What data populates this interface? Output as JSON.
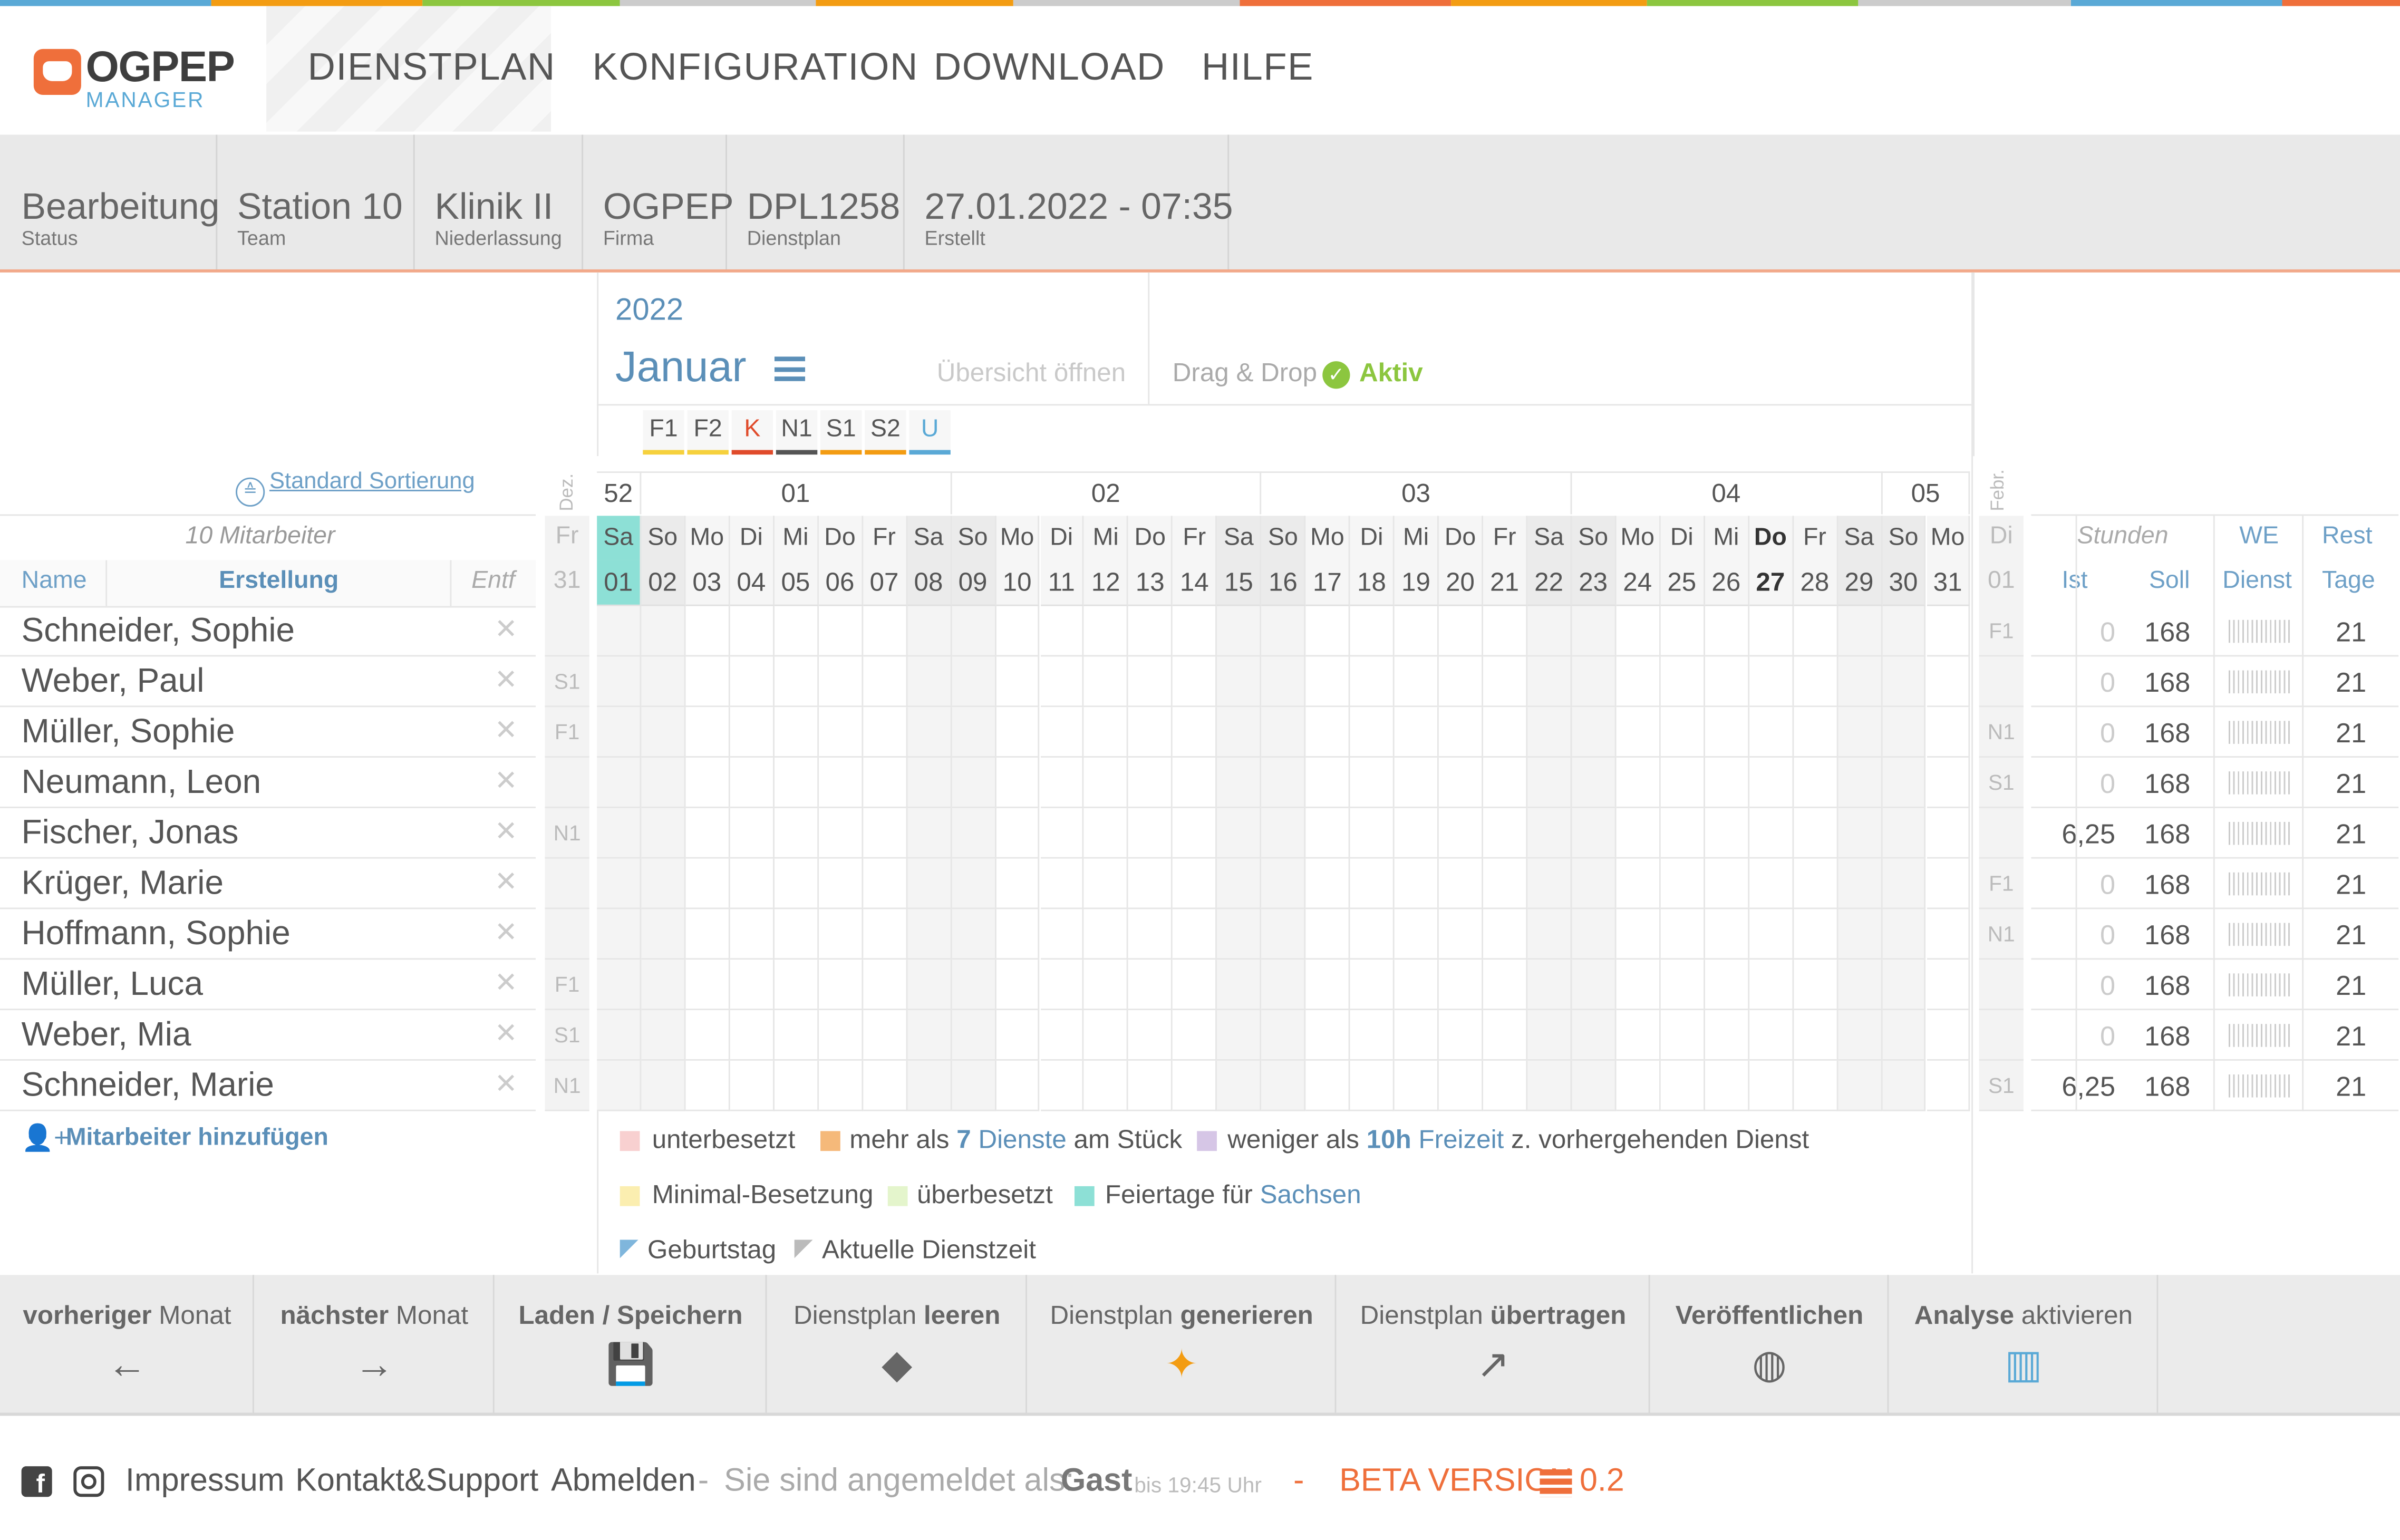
{
  "nav": {
    "logo_main": "OGPEP",
    "logo_sub": "MANAGER",
    "items": [
      "DIENSTPLAN",
      "KONFIGURATION",
      "DOWNLOAD",
      "HILFE"
    ]
  },
  "info": [
    {
      "value": "Bearbeitung",
      "label": "Status"
    },
    {
      "value": "Station 10",
      "label": "Team"
    },
    {
      "value": "Klinik II",
      "label": "Niederlassung"
    },
    {
      "value": "OGPEP",
      "label": "Firma"
    },
    {
      "value": "DPL1258",
      "label": "Dienstplan"
    },
    {
      "value": "27.01.2022 - 07:35",
      "label": "Erstellt"
    }
  ],
  "calendar": {
    "year": "2022",
    "month": "Januar",
    "overview_link": "Übersicht öffnen",
    "dragdrop_label": "Drag & Drop",
    "dragdrop_status": "Aktiv",
    "prev_month_label": "Dez.",
    "next_month_label": "Febr.",
    "shift_types": [
      {
        "code": "F1",
        "color": "#f6d13d"
      },
      {
        "code": "F2",
        "color": "#f6d13d"
      },
      {
        "code": "K",
        "color": "#e04b2b"
      },
      {
        "code": "N1",
        "color": "#555555"
      },
      {
        "code": "S1",
        "color": "#f39c12"
      },
      {
        "code": "S2",
        "color": "#f39c12"
      },
      {
        "code": "U",
        "color": "#5aa9d6"
      }
    ],
    "weeks": [
      "52",
      "01",
      "02",
      "03",
      "04",
      "05"
    ],
    "prev_day": {
      "dow": "Fr",
      "num": "31"
    },
    "next_day": {
      "dow": "Di",
      "num": "01"
    },
    "days": [
      {
        "dow": "Sa",
        "num": "01"
      },
      {
        "dow": "So",
        "num": "02"
      },
      {
        "dow": "Mo",
        "num": "03"
      },
      {
        "dow": "Di",
        "num": "04"
      },
      {
        "dow": "Mi",
        "num": "05"
      },
      {
        "dow": "Do",
        "num": "06"
      },
      {
        "dow": "Fr",
        "num": "07"
      },
      {
        "dow": "Sa",
        "num": "08"
      },
      {
        "dow": "So",
        "num": "09"
      },
      {
        "dow": "Mo",
        "num": "10"
      },
      {
        "dow": "Di",
        "num": "11"
      },
      {
        "dow": "Mi",
        "num": "12"
      },
      {
        "dow": "Do",
        "num": "13"
      },
      {
        "dow": "Fr",
        "num": "14"
      },
      {
        "dow": "Sa",
        "num": "15"
      },
      {
        "dow": "So",
        "num": "16"
      },
      {
        "dow": "Mo",
        "num": "17"
      },
      {
        "dow": "Di",
        "num": "18"
      },
      {
        "dow": "Mi",
        "num": "19"
      },
      {
        "dow": "Do",
        "num": "20"
      },
      {
        "dow": "Fr",
        "num": "21"
      },
      {
        "dow": "Sa",
        "num": "22"
      },
      {
        "dow": "So",
        "num": "23"
      },
      {
        "dow": "Mo",
        "num": "24"
      },
      {
        "dow": "Di",
        "num": "25"
      },
      {
        "dow": "Mi",
        "num": "26"
      },
      {
        "dow": "Do",
        "num": "27"
      },
      {
        "dow": "Fr",
        "num": "28"
      },
      {
        "dow": "Sa",
        "num": "29"
      },
      {
        "dow": "So",
        "num": "30"
      },
      {
        "dow": "Mo",
        "num": "31"
      }
    ],
    "holiday_color": "#8de0d6",
    "today": "27"
  },
  "employees": {
    "sort_link": "Standard Sortierung",
    "count_label": "10 Mitarbeiter",
    "col_name": "Name",
    "col_created": "Erstellung",
    "col_remove": "Entf",
    "add_label": "Mitarbeiter hinzufügen",
    "rows": [
      {
        "name": "Schneider, Sophie",
        "prev": "",
        "next": "F1",
        "ist": "0",
        "soll": "168",
        "rest": "21"
      },
      {
        "name": "Weber, Paul",
        "prev": "S1",
        "next": "",
        "ist": "0",
        "soll": "168",
        "rest": "21"
      },
      {
        "name": "Müller, Sophie",
        "prev": "F1",
        "next": "N1",
        "ist": "0",
        "soll": "168",
        "rest": "21"
      },
      {
        "name": "Neumann, Leon",
        "prev": "",
        "next": "S1",
        "ist": "0",
        "soll": "168",
        "rest": "21"
      },
      {
        "name": "Fischer, Jonas",
        "prev": "N1",
        "next": "",
        "ist": "6,25",
        "soll": "168",
        "rest": "21"
      },
      {
        "name": "Krüger, Marie",
        "prev": "",
        "next": "F1",
        "ist": "0",
        "soll": "168",
        "rest": "21"
      },
      {
        "name": "Hoffmann, Sophie",
        "prev": "",
        "next": "N1",
        "ist": "0",
        "soll": "168",
        "rest": "21"
      },
      {
        "name": "Müller, Luca",
        "prev": "F1",
        "next": "",
        "ist": "0",
        "soll": "168",
        "rest": "21"
      },
      {
        "name": "Weber, Mia",
        "prev": "S1",
        "next": "",
        "ist": "0",
        "soll": "168",
        "rest": "21"
      },
      {
        "name": "Schneider, Marie",
        "prev": "N1",
        "next": "S1",
        "ist": "6,25",
        "soll": "168",
        "rest": "21"
      }
    ]
  },
  "stats": {
    "hours_label": "Stunden",
    "ist_label": "Ist",
    "soll_label": "Soll",
    "we_label": "WE",
    "dienst_label": "Dienst",
    "rest_label": "Rest",
    "tage_label": "Tage"
  },
  "legend": {
    "understaffed": "unterbesetzt",
    "more_than_a": "mehr als",
    "more_than_num": "7",
    "more_than_b": "Dienste",
    "more_than_c": "am Stück",
    "less_than_a": "weniger als",
    "less_than_num": "10h",
    "less_than_b": "Freizeit",
    "less_than_c": "z. vorhergehenden Dienst",
    "minimal": "Minimal-Besetzung",
    "overstaffed": "überbesetzt",
    "holidays_a": "Feiertage für",
    "holidays_b": "Sachsen",
    "birthday": "Geburtstag",
    "current_shift": "Aktuelle Dienstzeit"
  },
  "toolbar": [
    {
      "a": "vorheriger",
      "b": " Monat",
      "icon": "←",
      "name": "prev-month-button"
    },
    {
      "a": "nächster",
      "b": " Monat",
      "icon": "→",
      "name": "next-month-button"
    },
    {
      "a": "Laden / Speichern",
      "b": "",
      "icon": "💾",
      "name": "load-save-button"
    },
    {
      "a": "Dienstplan ",
      "b": "leeren",
      "icon": "◆",
      "name": "clear-plan-button"
    },
    {
      "a": "Dienstplan ",
      "b": "generieren",
      "icon": "✦",
      "name": "generate-plan-button"
    },
    {
      "a": "Dienstplan ",
      "b": "übertragen",
      "icon": "↗",
      "name": "transfer-plan-button"
    },
    {
      "a": "Veröffentlichen",
      "b": "",
      "icon": "◍",
      "name": "publish-button"
    },
    {
      "a": "Analyse",
      "b": " aktivieren",
      "icon": "▥",
      "name": "analysis-button"
    }
  ],
  "footer": {
    "impressum": "Impressum",
    "kontakt": "Kontakt&Support",
    "abmelden": "Abmelden",
    "sep": "-",
    "logged_in": "Sie sind angemeldet als:",
    "user": "Gast",
    "until": "bis 19:45 Uhr",
    "beta": "BETA VERSION",
    "version": "0.2"
  }
}
